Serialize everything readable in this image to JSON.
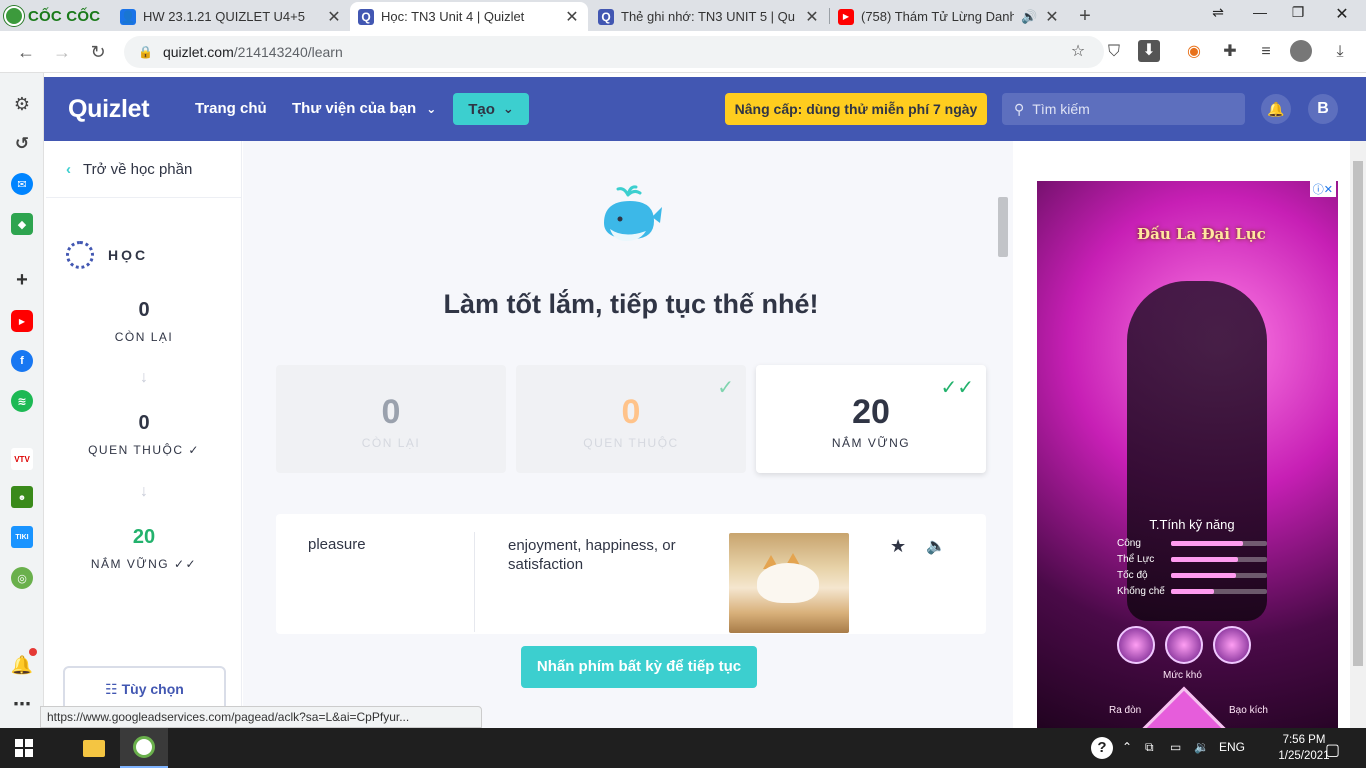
{
  "browser": {
    "brand": "CỐC CỐC",
    "tabs": [
      {
        "title": "HW 23.1.21 QUIZLET U4+5",
        "icon": "classroom-icon",
        "color": "#1a73e8"
      },
      {
        "title": "Học: TN3 Unit 4 | Quizlet",
        "icon": "quizlet-icon",
        "color": "#4257b2"
      },
      {
        "title": "Thẻ ghi nhớ: TN3 UNIT 5 | Qu",
        "icon": "quizlet-icon",
        "color": "#4257b2"
      },
      {
        "title": "(758) Thám Tử Lừng Danh",
        "icon": "youtube-icon",
        "color": "#ff0000"
      }
    ],
    "url_host": "quizlet.com",
    "url_path": "/214143240/learn",
    "status_url": "https://www.googleadservices.com/pagead/aclk?sa=L&ai=CpPfyur..."
  },
  "header": {
    "logo": "Quizlet",
    "nav_home": "Trang chủ",
    "nav_library": "Thư viện của bạn",
    "create": "Tạo",
    "upgrade": "Nâng cấp: dùng thử miễn phí 7 ngày",
    "search_placeholder": "Tìm kiếm",
    "avatar": "B"
  },
  "sidebar": {
    "back": "Trở về học phần",
    "mode": "HỌC",
    "remaining_count": "0",
    "remaining_label": "CÒN LẠI",
    "familiar_count": "0",
    "familiar_label": "QUEN THUỘC",
    "mastered_count": "20",
    "mastered_label": "NẮM VỮNG",
    "options": "Tùy chọn"
  },
  "main": {
    "headline": "Làm tốt lắm, tiếp tục thế nhé!",
    "cards": [
      {
        "count": "0",
        "label": "CÒN LẠI"
      },
      {
        "count": "0",
        "label": "QUEN THUỘC"
      },
      {
        "count": "20",
        "label": "NẮM VỮNG"
      }
    ],
    "term": "pleasure",
    "definition": "enjoyment, happiness, or satisfaction",
    "continue": "Nhấn phím bất kỳ để tiếp tục"
  },
  "ad": {
    "game_title": "Đấu La Đại Lục",
    "stats_title": "T.Tính kỹ năng",
    "stats": [
      {
        "name": "Công",
        "level": 0.75
      },
      {
        "name": "Thể Lực",
        "level": 0.7
      },
      {
        "name": "Tốc độ",
        "level": 0.68
      },
      {
        "name": "Khống chế",
        "level": 0.45
      }
    ],
    "difficulty": "Mức khó",
    "left_label": "Ra đòn",
    "right_label": "Bạo kích"
  },
  "taskbar": {
    "lang": "ENG",
    "time": "7:56 PM",
    "date": "1/25/2021"
  },
  "colors": {
    "quizlet_blue": "#4257b2",
    "teal": "#3ccfcf",
    "yellow": "#ffcd1f",
    "green": "#23b26d",
    "orange": "#ffb05d"
  }
}
